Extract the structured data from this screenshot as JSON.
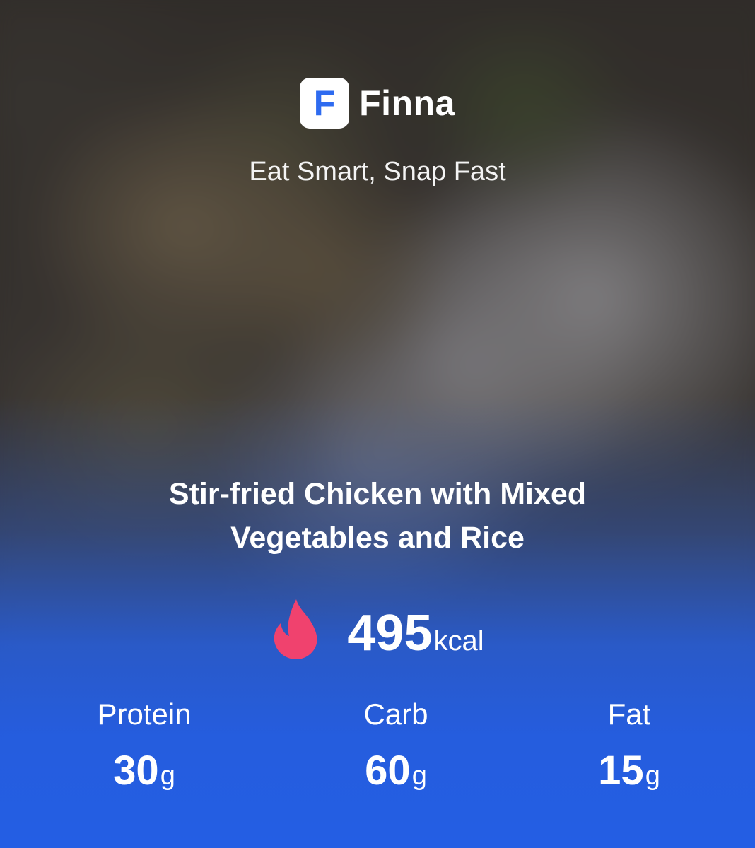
{
  "app": {
    "logo_letter": "F",
    "name": "Finna",
    "tagline": "Eat Smart, Snap Fast"
  },
  "meal": {
    "title": "Stir-fried Chicken with Mixed Vegetables and Rice"
  },
  "calories": {
    "value": "495",
    "unit": "kcal",
    "icon": "flame-icon",
    "icon_color": "#f0426e"
  },
  "macros": [
    {
      "label": "Protein",
      "value": "30",
      "unit": "g"
    },
    {
      "label": "Carb",
      "value": "60",
      "unit": "g"
    },
    {
      "label": "Fat",
      "value": "15",
      "unit": "g"
    }
  ],
  "colors": {
    "accent_blue": "#245ee4",
    "logo_letter": "#2e6bf0"
  }
}
